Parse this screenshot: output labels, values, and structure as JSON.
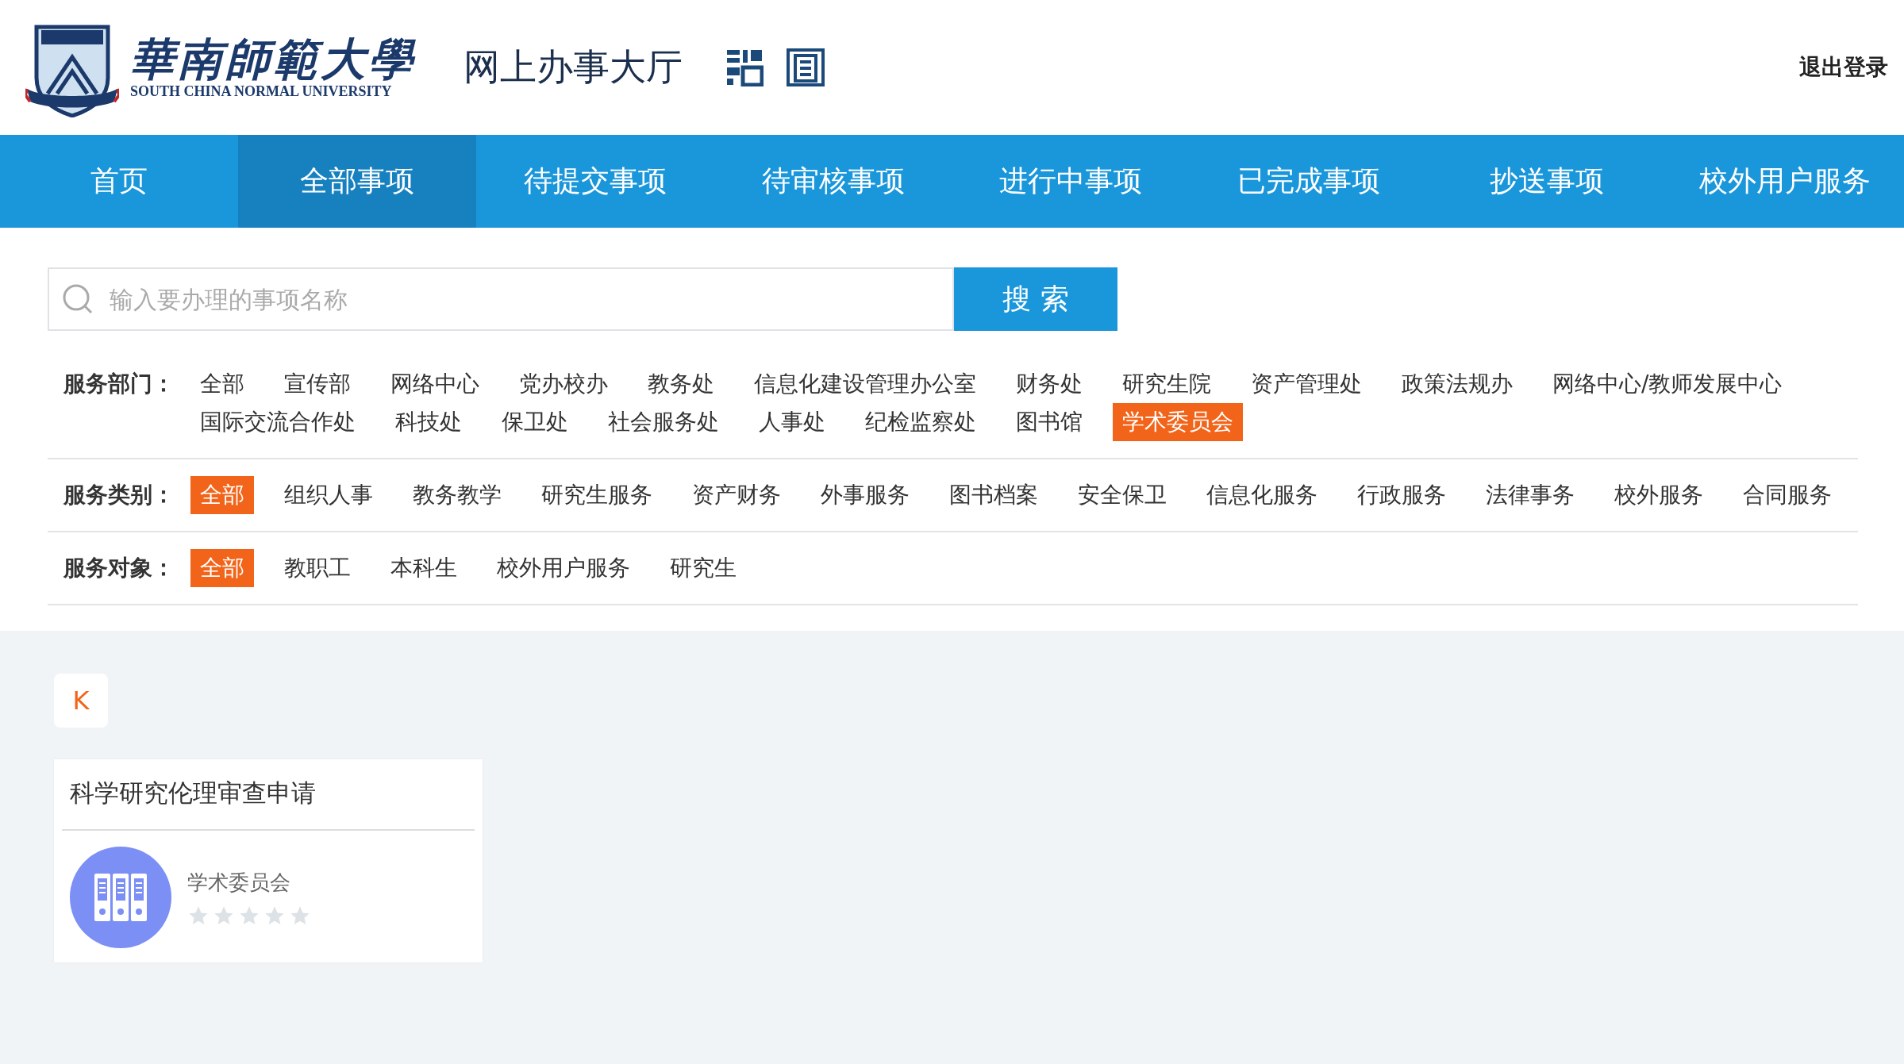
{
  "header": {
    "logo_chinese": "華南師範大學",
    "logo_english": "SOUTH CHINA NORMAL UNIVERSITY",
    "title": "网上办事大厅",
    "logout": "退出登录"
  },
  "nav": [
    {
      "label": "首页",
      "selected": false
    },
    {
      "label": "全部事项",
      "selected": true
    },
    {
      "label": "待提交事项",
      "selected": false
    },
    {
      "label": "待审核事项",
      "selected": false
    },
    {
      "label": "进行中事项",
      "selected": false
    },
    {
      "label": "已完成事项",
      "selected": false
    },
    {
      "label": "抄送事项",
      "selected": false
    },
    {
      "label": "校外用户服务",
      "selected": false
    }
  ],
  "search": {
    "placeholder": "输入要办理的事项名称",
    "button": "搜 索"
  },
  "filters": [
    {
      "label": "服务部门：",
      "options": [
        {
          "label": "全部",
          "selected": false
        },
        {
          "label": "宣传部",
          "selected": false
        },
        {
          "label": "网络中心",
          "selected": false
        },
        {
          "label": "党办校办",
          "selected": false
        },
        {
          "label": "教务处",
          "selected": false
        },
        {
          "label": "信息化建设管理办公室",
          "selected": false
        },
        {
          "label": "财务处",
          "selected": false
        },
        {
          "label": "研究生院",
          "selected": false
        },
        {
          "label": "资产管理处",
          "selected": false
        },
        {
          "label": "政策法规办",
          "selected": false
        },
        {
          "label": "网络中心/教师发展中心",
          "selected": false
        },
        {
          "label": "国际交流合作处",
          "selected": false
        },
        {
          "label": "科技处",
          "selected": false
        },
        {
          "label": "保卫处",
          "selected": false
        },
        {
          "label": "社会服务处",
          "selected": false
        },
        {
          "label": "人事处",
          "selected": false
        },
        {
          "label": "纪检监察处",
          "selected": false
        },
        {
          "label": "图书馆",
          "selected": false
        },
        {
          "label": "学术委员会",
          "selected": true
        }
      ]
    },
    {
      "label": "服务类别：",
      "options": [
        {
          "label": "全部",
          "selected": true
        },
        {
          "label": "组织人事",
          "selected": false
        },
        {
          "label": "教务教学",
          "selected": false
        },
        {
          "label": "研究生服务",
          "selected": false
        },
        {
          "label": "资产财务",
          "selected": false
        },
        {
          "label": "外事服务",
          "selected": false
        },
        {
          "label": "图书档案",
          "selected": false
        },
        {
          "label": "安全保卫",
          "selected": false
        },
        {
          "label": "信息化服务",
          "selected": false
        },
        {
          "label": "行政服务",
          "selected": false
        },
        {
          "label": "法律事务",
          "selected": false
        },
        {
          "label": "校外服务",
          "selected": false
        },
        {
          "label": "合同服务",
          "selected": false
        }
      ]
    },
    {
      "label": "服务对象：",
      "options": [
        {
          "label": "全部",
          "selected": true
        },
        {
          "label": "教职工",
          "selected": false
        },
        {
          "label": "本科生",
          "selected": false
        },
        {
          "label": "校外用户服务",
          "selected": false
        },
        {
          "label": "研究生",
          "selected": false
        }
      ]
    }
  ],
  "letter": "K",
  "cards": [
    {
      "title": "科学研究伦理审查申请",
      "department": "学术委员会",
      "stars": 0
    }
  ]
}
